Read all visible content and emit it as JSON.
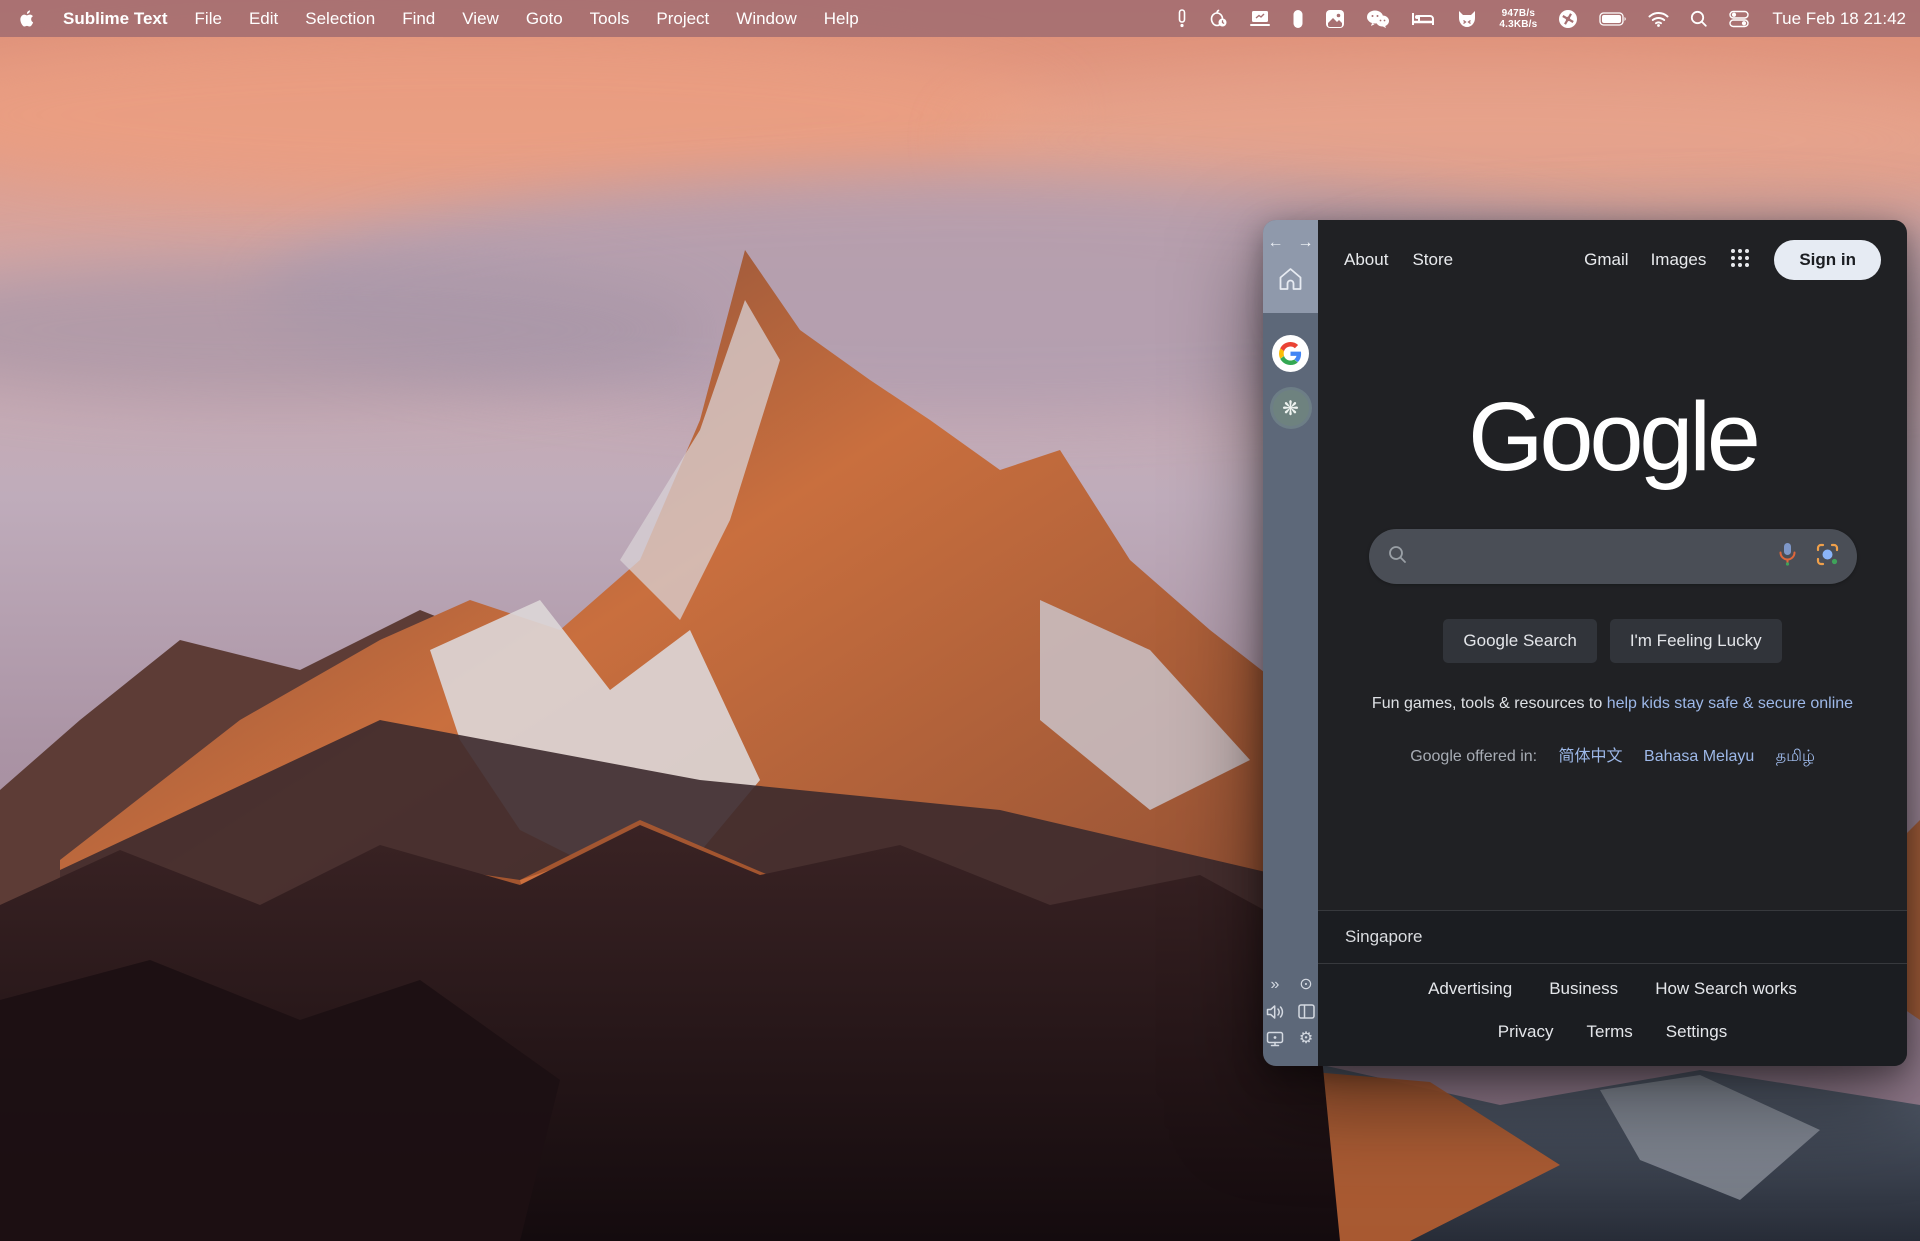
{
  "menubar": {
    "apple_menu_icon": "apple-icon",
    "app_name": "Sublime Text",
    "menus": [
      "File",
      "Edit",
      "Selection",
      "Find",
      "View",
      "Goto",
      "Tools",
      "Project",
      "Window",
      "Help"
    ],
    "status_icons": [
      "pin-icon",
      "battery-health-icon",
      "display-chart-icon",
      "notch-icon",
      "photos-icon",
      "wechat-icon",
      "bed-icon",
      "runcat-icon",
      "proxy-icon",
      "battery-icon",
      "wifi-icon",
      "spotlight-icon",
      "control-center-icon"
    ],
    "net_up": "947B/s",
    "net_down": "4.3KB/s",
    "clock": "Tue Feb 18 21:42"
  },
  "browser": {
    "sidebar": {
      "top_icons": [
        "back-arrow-icon",
        "forward-arrow-icon",
        "home-icon"
      ],
      "back_glyph": "←",
      "forward_glyph": "→",
      "tabs": [
        "google-favicon",
        "chatgpt-favicon"
      ],
      "chatgpt_glyph": "❋",
      "bottom_icons": [
        "expand-sidebar-icon",
        "record-icon",
        "volume-icon",
        "split-view-icon",
        "screen-share-icon",
        "settings-icon"
      ],
      "expand_glyph": "»",
      "record_glyph": "⊙",
      "settings_glyph": "⚙"
    },
    "header": {
      "left_links": [
        "About",
        "Store"
      ],
      "right_links": [
        "Gmail",
        "Images"
      ],
      "apps_icon": "apps-grid-icon",
      "sign_in": "Sign in"
    },
    "page": {
      "logo": "Google",
      "search_placeholder": "",
      "search_icons": [
        "search-magnifier-icon",
        "microphone-icon",
        "lens-camera-icon"
      ],
      "buttons": [
        "Google Search",
        "I'm Feeling Lucky"
      ],
      "promo_text": "Fun games, tools & resources to",
      "promo_link": "help kids stay safe & secure online",
      "offered_label": "Google offered in:",
      "offered_links": [
        "简体中文",
        "Bahasa Melayu",
        "தமிழ்"
      ],
      "footer": {
        "region": "Singapore",
        "row1": [
          "Advertising",
          "Business",
          "How Search works"
        ],
        "row2": [
          "Privacy",
          "Terms",
          "Settings"
        ]
      }
    },
    "colors": {
      "page_bg": "#202124",
      "footer_bg": "#1b1d21",
      "link_blue": "#9db8e8",
      "sidebar": "#5d6879",
      "sidebar_top": "#8f99ab",
      "signin_bg": "#e6ebf3",
      "search_pill": "#4a4e56",
      "button_bg": "#31343a",
      "menubar_tint": "#a77072"
    }
  }
}
